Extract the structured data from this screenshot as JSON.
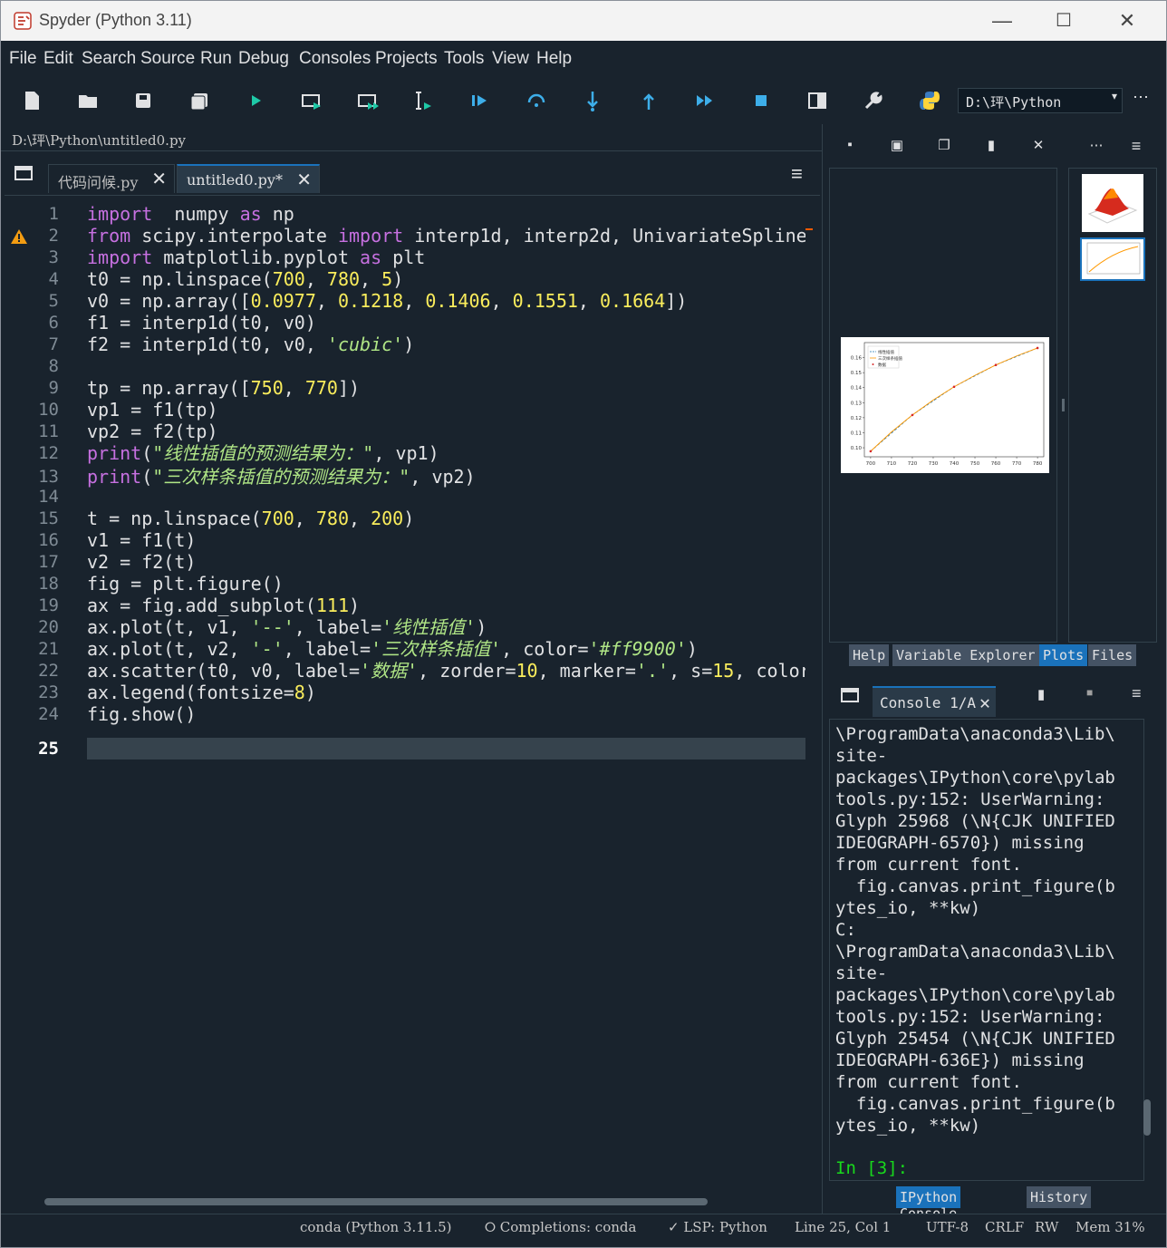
{
  "window": {
    "title": "Spyder (Python 3.11)",
    "min": "—",
    "max": "☐",
    "close": "✕"
  },
  "menu": [
    "File",
    "Edit",
    "Search",
    "Source",
    "Run",
    "Debug",
    "Consoles",
    "Projects",
    "Tools",
    "View",
    "Help"
  ],
  "toolbar": {
    "working_dir": "D:\\玶\\Python",
    "more": "⋯"
  },
  "editor": {
    "path": "D:\\玶\\Python\\untitled0.py",
    "tabs": [
      {
        "label": "代码问候.py",
        "close": "✕"
      },
      {
        "label": "untitled0.py*",
        "close": "✕"
      }
    ],
    "menu": "≡",
    "current_line": "25",
    "line_numbers": [
      "1",
      "2",
      "3",
      "4",
      "5",
      "6",
      "7",
      "8",
      "9",
      "10",
      "11",
      "12",
      "13",
      "14",
      "15",
      "16",
      "17",
      "18",
      "19",
      "20",
      "21",
      "22",
      "23",
      "24",
      "25"
    ],
    "lines": [
      [
        [
          "kw",
          "import"
        ],
        [
          "",
          "  numpy "
        ],
        [
          "kw",
          "as"
        ],
        [
          "",
          " np"
        ]
      ],
      [
        [
          "kw",
          "from"
        ],
        [
          "",
          " scipy.interpolate "
        ],
        [
          "kw",
          "import"
        ],
        [
          "",
          " interp1d, interp2d, UnivariateSpline"
        ]
      ],
      [
        [
          "kw",
          "import"
        ],
        [
          "",
          " matplotlib.pyplot "
        ],
        [
          "kw",
          "as"
        ],
        [
          "",
          " plt"
        ]
      ],
      [
        [
          "",
          "t0 = np.linspace("
        ],
        [
          "nm",
          "700"
        ],
        [
          "",
          ", "
        ],
        [
          "nm",
          "780"
        ],
        [
          "",
          ", "
        ],
        [
          "nm",
          "5"
        ],
        [
          "",
          ")"
        ]
      ],
      [
        [
          "",
          "v0 = np.array(["
        ],
        [
          "nm",
          "0.0977"
        ],
        [
          "",
          ", "
        ],
        [
          "nm",
          "0.1218"
        ],
        [
          "",
          ", "
        ],
        [
          "nm",
          "0.1406"
        ],
        [
          "",
          ", "
        ],
        [
          "nm",
          "0.1551"
        ],
        [
          "",
          ", "
        ],
        [
          "nm",
          "0.1664"
        ],
        [
          "",
          "])"
        ]
      ],
      [
        [
          "",
          "f1 = interp1d(t0, v0)"
        ]
      ],
      [
        [
          "",
          "f2 = interp1d(t0, v0, "
        ],
        [
          "st it",
          "'cubic'"
        ],
        [
          "",
          ")"
        ]
      ],
      [
        [
          "",
          ""
        ]
      ],
      [
        [
          "",
          "tp = np.array(["
        ],
        [
          "nm",
          "750"
        ],
        [
          "",
          ", "
        ],
        [
          "nm",
          "770"
        ],
        [
          "",
          "])"
        ]
      ],
      [
        [
          "",
          "vp1 = f1(tp)"
        ]
      ],
      [
        [
          "",
          "vp2 = f2(tp)"
        ]
      ],
      [
        [
          "kw",
          "print"
        ],
        [
          "",
          "("
        ],
        [
          "st it",
          "\"线性插值的预测结果为：\""
        ],
        [
          "",
          ", vp1)"
        ]
      ],
      [
        [
          "kw",
          "print"
        ],
        [
          "",
          "("
        ],
        [
          "st it",
          "\"三次样条插值的预测结果为：\""
        ],
        [
          "",
          ", vp2)"
        ]
      ],
      [
        [
          "",
          ""
        ]
      ],
      [
        [
          "",
          "t = np.linspace("
        ],
        [
          "nm",
          "700"
        ],
        [
          "",
          ", "
        ],
        [
          "nm",
          "780"
        ],
        [
          "",
          ", "
        ],
        [
          "nm",
          "200"
        ],
        [
          "",
          ")"
        ]
      ],
      [
        [
          "",
          "v1 = f1(t)"
        ]
      ],
      [
        [
          "",
          "v2 = f2(t)"
        ]
      ],
      [
        [
          "",
          "fig = plt.figure()"
        ]
      ],
      [
        [
          "",
          "ax = fig.add_subplot("
        ],
        [
          "nm",
          "111"
        ],
        [
          "",
          ")"
        ]
      ],
      [
        [
          "",
          "ax.plot(t, v1, "
        ],
        [
          "st",
          "'--'"
        ],
        [
          "",
          ", label="
        ],
        [
          "st it",
          "'线性插值'"
        ],
        [
          "",
          ")"
        ]
      ],
      [
        [
          "",
          "ax.plot(t, v2, "
        ],
        [
          "st",
          "'-'"
        ],
        [
          "",
          ", label="
        ],
        [
          "st it",
          "'三次样条插值'"
        ],
        [
          "",
          ", color="
        ],
        [
          "st it",
          "'#ff9900'"
        ],
        [
          "",
          ")"
        ]
      ],
      [
        [
          "",
          "ax.scatter(t0, v0, label="
        ],
        [
          "st it",
          "'数据'"
        ],
        [
          "",
          ", zorder="
        ],
        [
          "nm",
          "10"
        ],
        [
          "",
          ", marker="
        ],
        [
          "st",
          "'.'"
        ],
        [
          "",
          ", s="
        ],
        [
          "nm",
          "15"
        ],
        [
          "",
          ", color"
        ]
      ],
      [
        [
          "",
          "ax.legend(fontsize="
        ],
        [
          "nm",
          "8"
        ],
        [
          "",
          ")"
        ]
      ],
      [
        [
          "",
          "fig.show()"
        ]
      ],
      [
        [
          "",
          ""
        ]
      ]
    ]
  },
  "plots": {
    "tabs": [
      "Help",
      "Variable Explorer",
      "Plots",
      "Files"
    ],
    "active_tab": "Plots",
    "toolbar": [
      "save-icon",
      "save-all-icon",
      "copy-icon",
      "delete-icon",
      "close-all-icon",
      "more-icon",
      "menu-icon"
    ],
    "legend": [
      "线性插值",
      "三次样条插值",
      "数据"
    ],
    "chart_data": {
      "type": "line",
      "x_ticks": [
        "700",
        "710",
        "720",
        "730",
        "740",
        "750",
        "760",
        "770",
        "780"
      ],
      "y_ticks": [
        "0.10",
        "0.11",
        "0.12",
        "0.13",
        "0.14",
        "0.15",
        "0.16"
      ],
      "xlim": [
        697,
        783
      ],
      "ylim": [
        0.094,
        0.17
      ],
      "series": [
        {
          "name": "线性插值",
          "x": [
            700,
            720,
            740,
            760,
            780
          ],
          "y": [
            0.0977,
            0.1218,
            0.1406,
            0.1551,
            0.1664
          ],
          "color": "#1f77b4"
        },
        {
          "name": "三次样条插值",
          "x": [
            700,
            710,
            720,
            730,
            740,
            750,
            760,
            770,
            780
          ],
          "y": [
            0.0977,
            0.1105,
            0.1218,
            0.1318,
            0.1406,
            0.1482,
            0.1551,
            0.1611,
            0.1664
          ],
          "color": "#ff9900"
        },
        {
          "name": "数据",
          "x": [
            700,
            720,
            740,
            760,
            780
          ],
          "y": [
            0.0977,
            0.1218,
            0.1406,
            0.1551,
            0.1664
          ],
          "color": "#d62728"
        }
      ]
    }
  },
  "console": {
    "tab": "Console 1/A",
    "text": "\\ProgramData\\anaconda3\\Lib\\\nsite-\npackages\\IPython\\core\\pylab\ntools.py:152: UserWarning:\nGlyph 25968 (\\N{CJK UNIFIED\nIDEOGRAPH-6570}) missing\nfrom current font.\n  fig.canvas.print_figure(b\nytes_io, **kw)\nC:\n\\ProgramData\\anaconda3\\Lib\\\nsite-\npackages\\IPython\\core\\pylab\ntools.py:152: UserWarning:\nGlyph 25454 (\\N{CJK UNIFIED\nIDEOGRAPH-636E}) missing\nfrom current font.\n  fig.canvas.print_figure(b\nytes_io, **kw)",
    "prompt": "In [3]:",
    "tabs": [
      "IPython Console",
      "History"
    ]
  },
  "status": {
    "env": "conda (Python 3.11.5)",
    "completions": "⭘ Completions: conda",
    "lsp": "✓ LSP: Python",
    "position": "Line 25, Col 1",
    "encoding": "UTF-8",
    "eol": "CRLF",
    "rw": "RW",
    "mem": "Mem 31%"
  },
  "colors": {
    "bg": "#19232d",
    "accent": "#1a72bb",
    "keyword": "#c670e0",
    "number": "#faed5c",
    "string": "#b0e686",
    "prompt": "#18d91c"
  }
}
